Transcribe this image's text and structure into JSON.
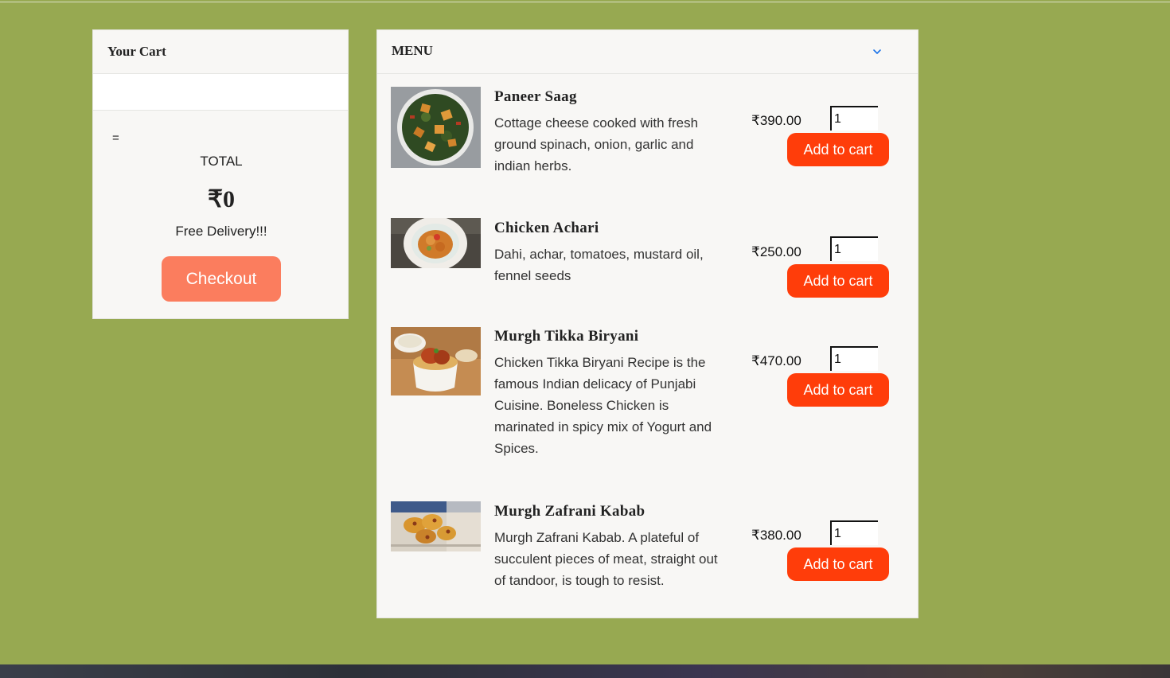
{
  "cart": {
    "title": "Your Cart",
    "equation": "=",
    "total_label": "TOTAL",
    "total_amount": "₹0",
    "delivery_note": "Free Delivery!!!",
    "checkout_label": "Checkout"
  },
  "menu": {
    "title": "MENU",
    "items": [
      {
        "name": "Paneer Saag",
        "description": "Cottage cheese cooked with fresh ground spinach, onion, garlic and indian herbs.",
        "price": "₹390.00",
        "quantity": "1",
        "button_label": "Add to cart"
      },
      {
        "name": "Chicken Achari",
        "description": "Dahi, achar, tomatoes, mustard oil, fennel seeds",
        "price": "₹250.00",
        "quantity": "1",
        "button_label": "Add to cart"
      },
      {
        "name": "Murgh Tikka Biryani",
        "description": "Chicken Tikka Biryani Recipe is the famous Indian delicacy of Punjabi Cuisine. Boneless Chicken is marinated in spicy mix of Yogurt and Spices.",
        "price": "₹470.00",
        "quantity": "1",
        "button_label": "Add to cart"
      },
      {
        "name": "Murgh Zafrani Kabab",
        "description": "Murgh Zafrani Kabab. A plateful of succulent pieces of meat, straight out of tandoor, is tough to resist.",
        "price": "₹380.00",
        "quantity": "1",
        "button_label": "Add to cart"
      }
    ]
  },
  "colors": {
    "page_background": "#97a951",
    "checkout_button": "#fb7d5e",
    "add_to_cart_button": "#ff3d0a",
    "chevron": "#1a73e8"
  }
}
